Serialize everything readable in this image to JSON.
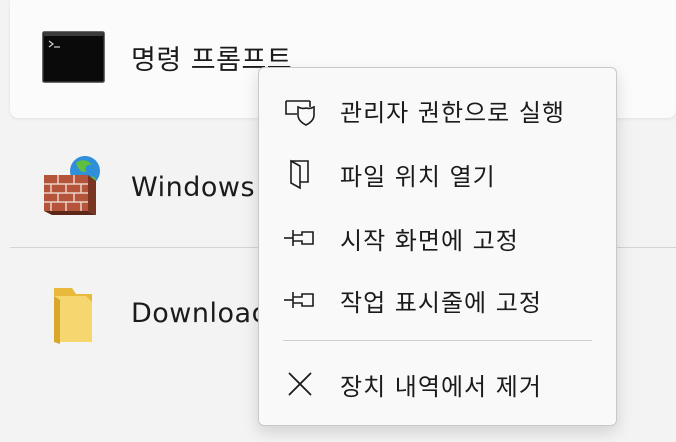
{
  "results": [
    {
      "label": "명령 프롬프트",
      "icon": "command-prompt-icon"
    },
    {
      "label": "Windows",
      "icon": "windows-firewall-icon"
    },
    {
      "label": "Download",
      "icon": "folder-icon"
    }
  ],
  "context_menu": {
    "items": [
      {
        "label": "관리자 권한으로 실행",
        "icon": "shield-icon"
      },
      {
        "label": "파일 위치 열기",
        "icon": "open-folder-icon"
      },
      {
        "label": "시작 화면에 고정",
        "icon": "pin-icon"
      },
      {
        "label": "작업 표시줄에 고정",
        "icon": "pin-icon"
      },
      {
        "label": "장치 내역에서 제거",
        "icon": "close-icon"
      }
    ]
  }
}
